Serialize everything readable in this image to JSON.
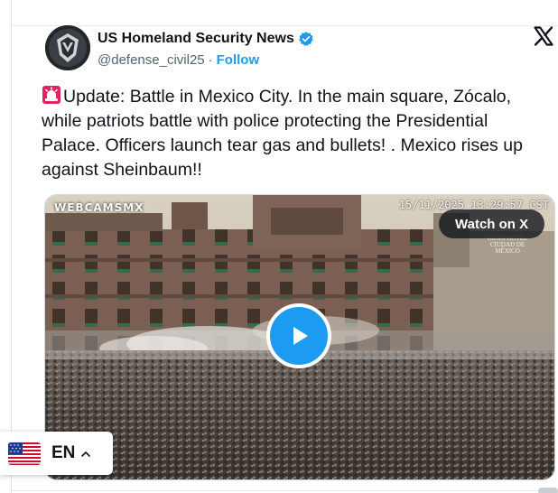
{
  "author": {
    "name": "US Homeland Security News",
    "handle": "@defense_civil25",
    "separator": "·",
    "follow_label": "Follow"
  },
  "icons": {
    "avatar": "shield-emblem-icon",
    "verified": "verified-badge-icon",
    "platform": "x-logo-icon",
    "siren": "police-siren-icon",
    "play": "play-icon",
    "flag": "us-flag-icon",
    "caret": "chevron-up-icon"
  },
  "tweet": {
    "text": "Update: Battle in Mexico City. In the main square, Zócalo, while patriots battle with police protecting the Presidential Palace. Officers launch tear gas and bullets! . Mexico rises up against Sheinbaum!!"
  },
  "media": {
    "watermark": "WEBCAMSMX",
    "timestamp": "15/11/2025  13:29:57  CST",
    "hotel_mark": "GRAN HOTEL CIUDAD DE MÉXICO",
    "watch_label": "Watch on X"
  },
  "language_widget": {
    "code": "EN"
  },
  "colors": {
    "accent": "#1d9bf0",
    "text": "#0f1419",
    "secondary": "#536471",
    "siren_red": "#e0245e"
  }
}
